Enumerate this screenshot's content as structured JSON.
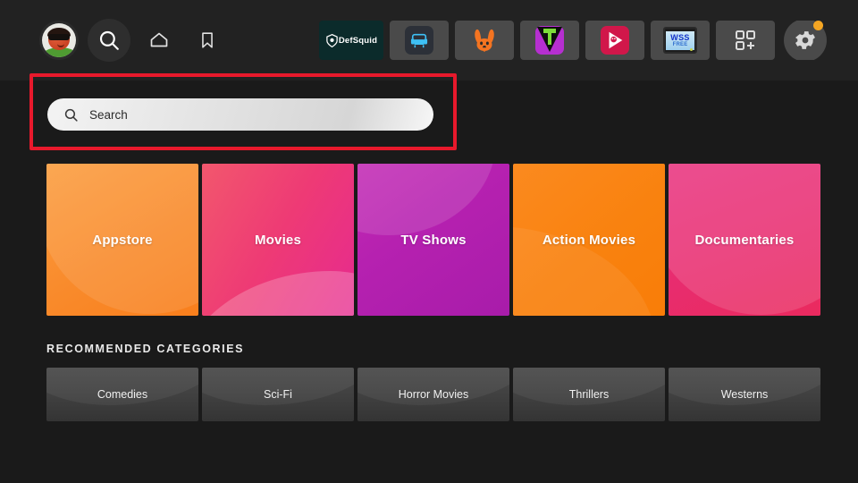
{
  "topbar": {
    "avatar_name": "profile-avatar",
    "nav": [
      {
        "name": "search-icon",
        "label": "Search"
      },
      {
        "name": "home-icon",
        "label": "Home"
      },
      {
        "name": "bookmark-icon",
        "label": "Bookmarks"
      }
    ],
    "apps": [
      {
        "name": "defsquid-app",
        "label": "DefSquid"
      },
      {
        "name": "couch-app",
        "label": "Couch"
      },
      {
        "name": "rabbit-app",
        "label": "Rabbit"
      },
      {
        "name": "tivimate-app",
        "label": "TiviMate"
      },
      {
        "name": "media-player-app",
        "label": "Media Player"
      },
      {
        "name": "wss-free-app",
        "label": "WSS FREE",
        "line1": "WSS",
        "line2": "FREE"
      },
      {
        "name": "add-apps-button",
        "label": "Add Apps"
      },
      {
        "name": "settings-button",
        "label": "Settings"
      }
    ]
  },
  "search": {
    "placeholder": "Search",
    "value": "",
    "icon": "search-icon",
    "highlight_color": "#e8192c"
  },
  "categories": [
    {
      "label": "Appstore",
      "color": "#f98b2c"
    },
    {
      "label": "Movies",
      "color": "#ee3a75"
    },
    {
      "label": "TV Shows",
      "color": "#b621b0"
    },
    {
      "label": "Action Movies",
      "color": "#f9820f"
    },
    {
      "label": "Documentaries",
      "color": "#e82c6e"
    }
  ],
  "recommended": {
    "heading": "RECOMMENDED CATEGORIES",
    "items": [
      {
        "label": "Comedies"
      },
      {
        "label": "Sci-Fi"
      },
      {
        "label": "Horror Movies"
      },
      {
        "label": "Thrillers"
      },
      {
        "label": "Westerns"
      }
    ]
  }
}
